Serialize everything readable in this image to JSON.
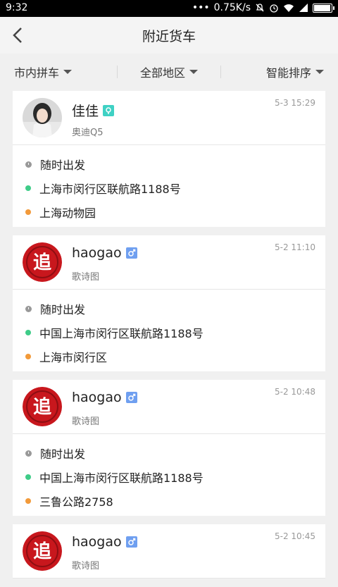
{
  "status": {
    "time": "9:32",
    "speed": "0.75K/s"
  },
  "header": {
    "title": "附近货车"
  },
  "filters": [
    "市内拼车",
    "全部地区",
    "智能排序"
  ],
  "cards": [
    {
      "name": "佳佳",
      "car": "奥迪Q5",
      "time": "5-3 15:29",
      "depart": "随时出发",
      "from": "上海市闵行区联航路1188号",
      "to": "上海动物园",
      "gender": "female"
    },
    {
      "name": "haogao",
      "car": "歌诗图",
      "time": "5-2 11:10",
      "depart": "随时出发",
      "from": "中国上海市闵行区联航路1188号",
      "to": "上海市闵行区",
      "gender": "male"
    },
    {
      "name": "haogao",
      "car": "歌诗图",
      "time": "5-2 10:48",
      "depart": "随时出发",
      "from": "中国上海市闵行区联航路1188号",
      "to": "三鲁公路2758",
      "gender": "male"
    },
    {
      "name": "haogao",
      "car": "歌诗图",
      "time": "5-2 10:45",
      "depart": "",
      "from": "",
      "to": "",
      "gender": "male"
    }
  ],
  "colors": {
    "green": "#3fcc88",
    "orange": "#f29a3a",
    "male": "#6f9ff0",
    "female": "#3fd1c4",
    "brand_red": "#c8171d"
  }
}
